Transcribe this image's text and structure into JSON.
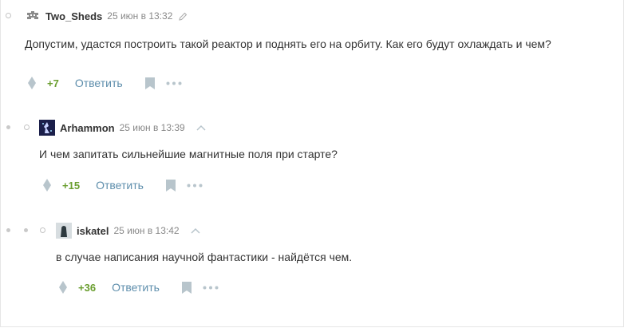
{
  "comments": [
    {
      "username": "Two_Sheds",
      "time": "25 июн в 13:32",
      "text": "Допустим, удастся построить такой реактор и поднять его на орбиту. Как его будут охлаждать и чем?",
      "score": "+7",
      "reply_label": "Ответить",
      "edited_icon": "pencil-icon"
    },
    {
      "username": "Arhammon",
      "time": "25 июн в 13:39",
      "text": "И чем запитать сильнейшие магнитные поля при старте?",
      "score": "+15",
      "reply_label": "Ответить",
      "parent_icon": "chevron-up-icon"
    },
    {
      "username": "iskatel",
      "time": "25 июн в 13:42",
      "text": "в случае написания научной фантастики - найдётся чем.",
      "score": "+36",
      "reply_label": "Ответить",
      "parent_icon": "chevron-up-icon"
    }
  ],
  "colors": {
    "score": "#6a9e2f",
    "reply_link": "#5e8eac",
    "icon": "#b8c5cc",
    "muted": "#888888"
  }
}
